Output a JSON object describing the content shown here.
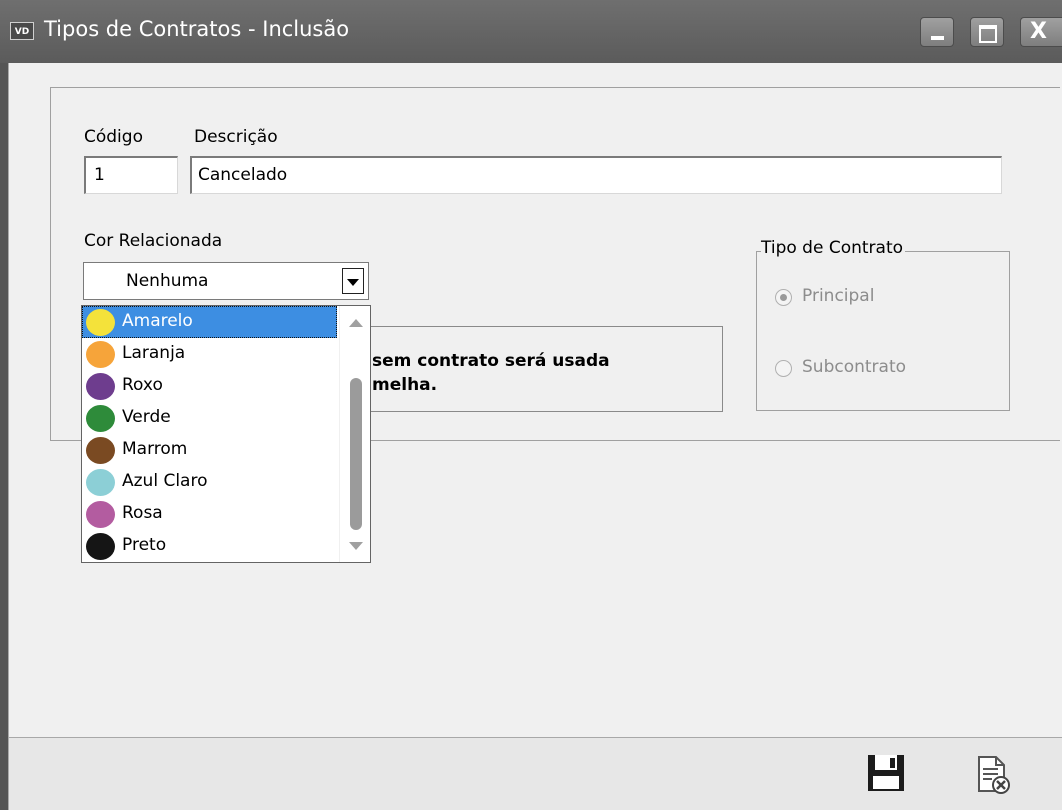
{
  "window": {
    "icon_text": "VD",
    "title": "Tipos de Contratos - Inclusão",
    "minimize_glyph": "",
    "close_glyph": "X"
  },
  "form": {
    "codigo_label": "Código",
    "codigo_value": "1",
    "descricao_label": "Descrição",
    "descricao_value": "Cancelado",
    "cor_label": "Cor Relacionada",
    "cor_selected": "Nenhuma"
  },
  "color_dropdown": {
    "items": [
      {
        "label": "Amarelo",
        "color": "#f4e23a",
        "selected": true
      },
      {
        "label": "Laranja",
        "color": "#f6a43a",
        "selected": false
      },
      {
        "label": "Roxo",
        "color": "#6e3d8e",
        "selected": false
      },
      {
        "label": "Verde",
        "color": "#2e8b3a",
        "selected": false
      },
      {
        "label": "Marrom",
        "color": "#7a4a22",
        "selected": false
      },
      {
        "label": "Azul Claro",
        "color": "#8ccfd6",
        "selected": false
      },
      {
        "label": "Rosa",
        "color": "#b35ca0",
        "selected": false
      },
      {
        "label": "Preto",
        "color": "#151515",
        "selected": false
      }
    ]
  },
  "info": {
    "text_line1": "sem contrato será usada",
    "text_line2": "melha."
  },
  "tipo_contrato": {
    "legend": "Tipo de Contrato",
    "options": [
      {
        "label": "Principal",
        "checked": true
      },
      {
        "label": "Subcontrato",
        "checked": false
      }
    ]
  },
  "footer": {
    "save_icon": "save-icon",
    "cancel_icon": "cancel-document-icon"
  }
}
